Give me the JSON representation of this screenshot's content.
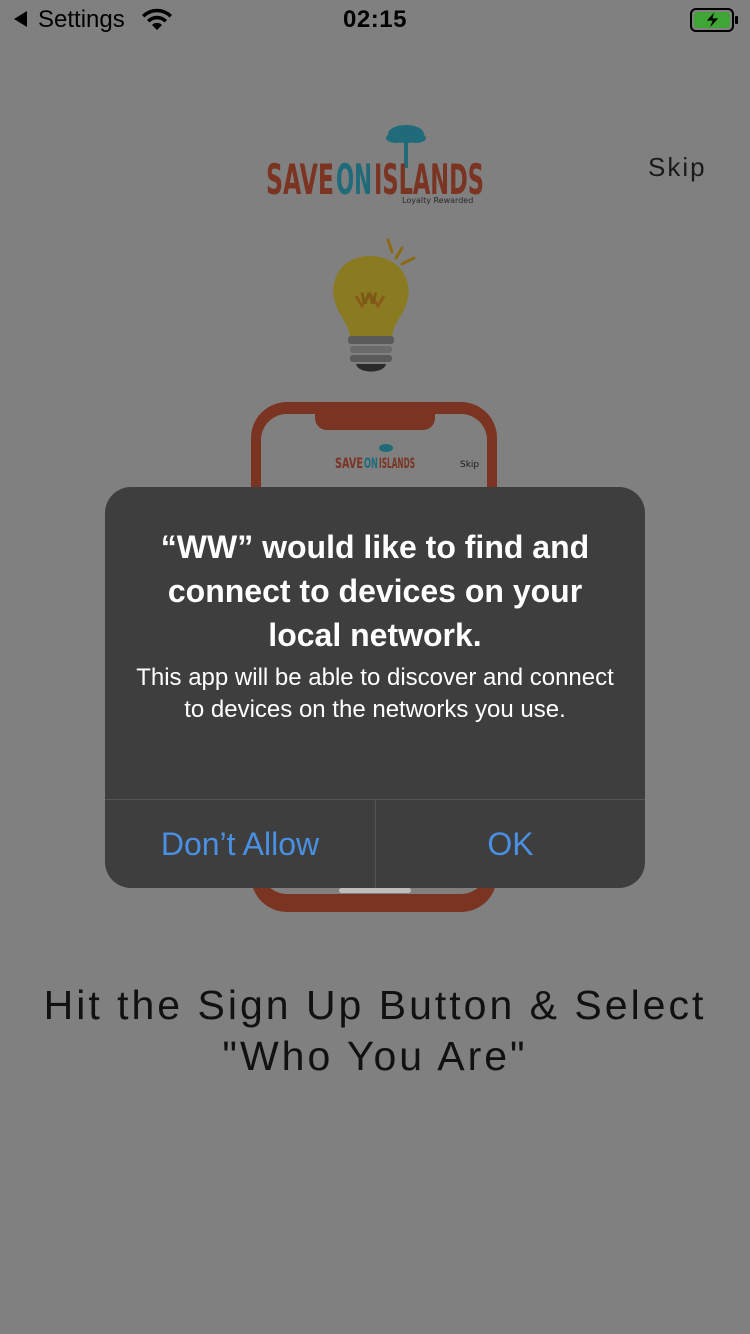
{
  "status_bar": {
    "back_label": "Settings",
    "time": "02:15",
    "icons": [
      "back-caret-icon",
      "wifi-icon",
      "battery-charging-icon"
    ],
    "battery_color": "#3fa535"
  },
  "header": {
    "logo_text_save": "SAVE",
    "logo_text_on": "ON",
    "logo_text_islands": "ISLANDS",
    "logo_tagline": "Loyalty Rewarded",
    "skip_label": "Skip"
  },
  "illustration": {
    "bulb_letter": "W",
    "phone_logo_save": "SAVE",
    "phone_logo_on": "ON",
    "phone_logo_islands": "ISLANDS",
    "phone_skip": "Skip"
  },
  "dialog": {
    "title": "“WW” would like to find and connect to devices on your local network.",
    "message": "This app will be able to discover and connect to devices on the networks you use.",
    "deny_label": "Don’t Allow",
    "ok_label": "OK"
  },
  "caption": {
    "line1": "Hit the Sign Up Button & Select",
    "line2": "\"Who You Are\""
  },
  "colors": {
    "dim_background": "#808080",
    "brand_red": "#7b3322",
    "brand_teal": "#1f6b7a",
    "dialog_bg": "#3e3e3e",
    "dialog_button": "#4a90e2"
  }
}
